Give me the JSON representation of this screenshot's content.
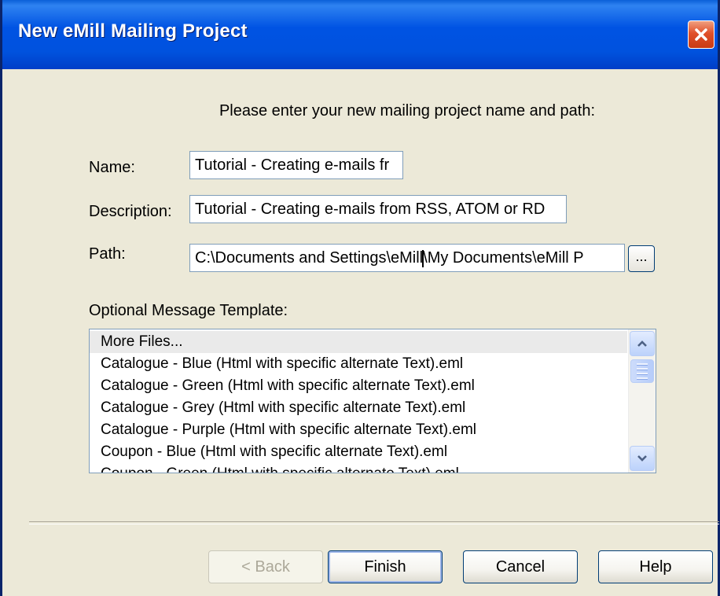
{
  "window": {
    "title": "New eMill Mailing Project",
    "close_icon": "close-icon"
  },
  "prompt": "Please enter your new mailing project name and path:",
  "form": {
    "name_label": "Name:",
    "name_value": "Tutorial - Creating e-mails fr",
    "description_label": "Description:",
    "description_value": "Tutorial - Creating e-mails from RSS, ATOM or RD",
    "path_label": "Path:",
    "path_value_before_caret": "C:\\Documents and Settings\\eMill",
    "path_value_after_caret": "\\My Documents\\eMill P",
    "browse_label": "...",
    "template_label": "Optional Message Template:"
  },
  "templates": [
    "More Files...",
    "Catalogue - Blue (Html with specific alternate Text).eml",
    "Catalogue - Green (Html with specific alternate Text).eml",
    "Catalogue - Grey (Html with specific alternate Text).eml",
    "Catalogue - Purple (Html with specific alternate Text).eml",
    "Coupon - Blue (Html with specific alternate Text).eml",
    "Coupon - Green (Html with specific alternate Text).eml"
  ],
  "buttons": {
    "back": "< Back",
    "finish": "Finish",
    "cancel": "Cancel",
    "help": "Help"
  },
  "colors": {
    "titlebar": "#0053e3",
    "dialog_bg": "#ece9d8",
    "close_button": "#e0502a"
  }
}
